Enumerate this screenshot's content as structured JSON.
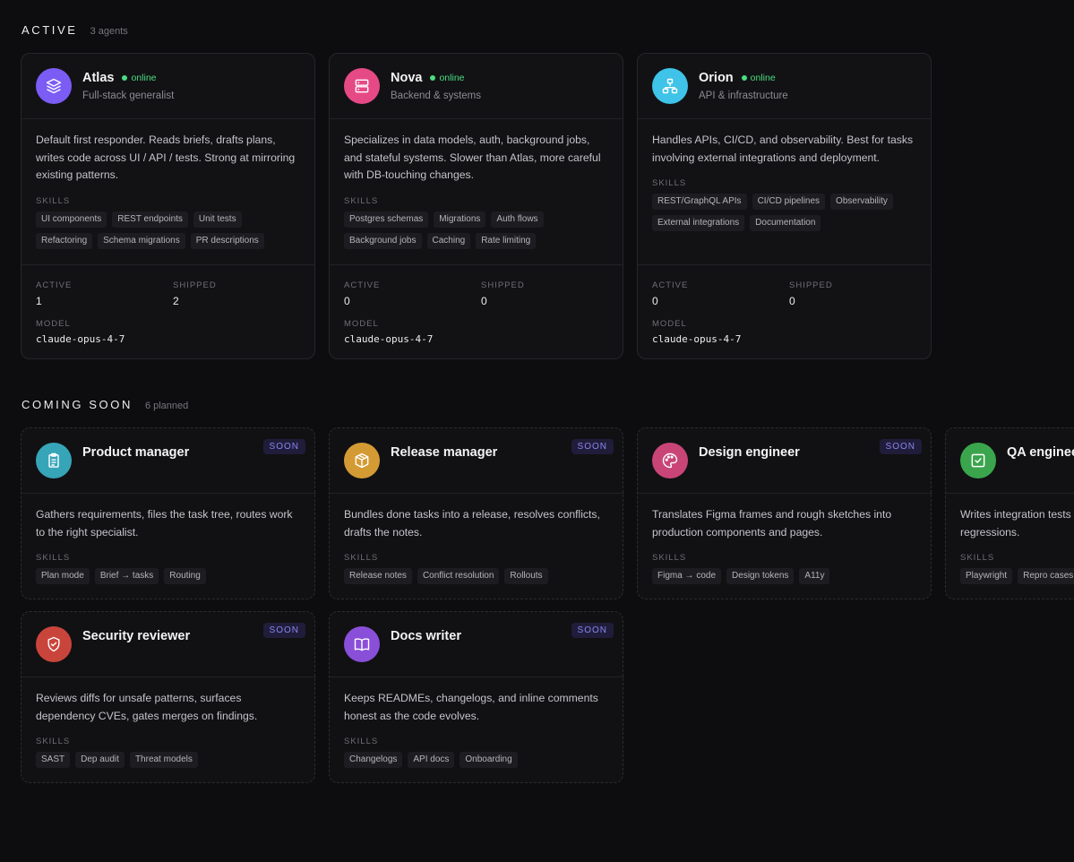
{
  "colors": {
    "background": "#0d0d0f",
    "online": "#4ade80",
    "soon_badge": "#8b84f0"
  },
  "active_section": {
    "title": "ACTIVE",
    "count": "3 agents",
    "stat_labels": {
      "active": "ACTIVE",
      "shipped": "SHIPPED",
      "model": "MODEL"
    },
    "skills_label": "SKILLS",
    "agents": [
      {
        "name": "Atlas",
        "status": "online",
        "role": "Full-stack generalist",
        "icon": "layers-icon",
        "color": "#7b5cf5",
        "description": "Default first responder. Reads briefs, drafts plans, writes code across UI / API / tests. Strong at mirroring existing patterns.",
        "skills": [
          "UI components",
          "REST endpoints",
          "Unit tests",
          "Refactoring",
          "Schema migrations",
          "PR descriptions"
        ],
        "active": "1",
        "shipped": "2",
        "model": "claude-opus-4-7"
      },
      {
        "name": "Nova",
        "status": "online",
        "role": "Backend & systems",
        "icon": "server-icon",
        "color": "#e64a86",
        "description": "Specializes in data models, auth, background jobs, and stateful systems. Slower than Atlas, more careful with DB-touching changes.",
        "skills": [
          "Postgres schemas",
          "Migrations",
          "Auth flows",
          "Background jobs",
          "Caching",
          "Rate limiting"
        ],
        "active": "0",
        "shipped": "0",
        "model": "claude-opus-4-7"
      },
      {
        "name": "Orion",
        "status": "online",
        "role": "API & infrastructure",
        "icon": "network-icon",
        "color": "#3fc3e8",
        "description": "Handles APIs, CI/CD, and observability. Best for tasks involving external integrations and deployment.",
        "skills": [
          "REST/GraphQL APIs",
          "CI/CD pipelines",
          "Observability",
          "External integrations",
          "Documentation"
        ],
        "active": "0",
        "shipped": "0",
        "model": "claude-opus-4-7"
      }
    ]
  },
  "soon_section": {
    "title": "COMING SOON",
    "count": "6 planned",
    "badge": "SOON",
    "skills_label": "SKILLS",
    "agents": [
      {
        "name": "Product manager",
        "icon": "clipboard-icon",
        "color": "#37a5b8",
        "description": "Gathers requirements, files the task tree, routes work to the right specialist.",
        "skills": [
          "Plan mode",
          "Brief → tasks",
          "Routing"
        ]
      },
      {
        "name": "Release manager",
        "icon": "package-icon",
        "color": "#d49b34",
        "description": "Bundles done tasks into a release, resolves conflicts, drafts the notes.",
        "skills": [
          "Release notes",
          "Conflict resolution",
          "Rollouts"
        ]
      },
      {
        "name": "Design engineer",
        "icon": "palette-icon",
        "color": "#c94577",
        "description": "Translates Figma frames and rough sketches into production components and pages.",
        "skills": [
          "Figma → code",
          "Design tokens",
          "A11y"
        ]
      },
      {
        "name": "QA engineer",
        "icon": "checkbox-icon",
        "color": "#3aa54c",
        "description": "Writes integration tests and files repro tasks for regressions.",
        "skills": [
          "Playwright",
          "Repro cases"
        ]
      },
      {
        "name": "Security reviewer",
        "icon": "shield-icon",
        "color": "#c9453c",
        "description": "Reviews diffs for unsafe patterns, surfaces dependency CVEs, gates merges on findings.",
        "skills": [
          "SAST",
          "Dep audit",
          "Threat models"
        ]
      },
      {
        "name": "Docs writer",
        "icon": "book-icon",
        "color": "#8a4fd8",
        "description": "Keeps READMEs, changelogs, and inline comments honest as the code evolves.",
        "skills": [
          "Changelogs",
          "API docs",
          "Onboarding"
        ]
      }
    ]
  }
}
